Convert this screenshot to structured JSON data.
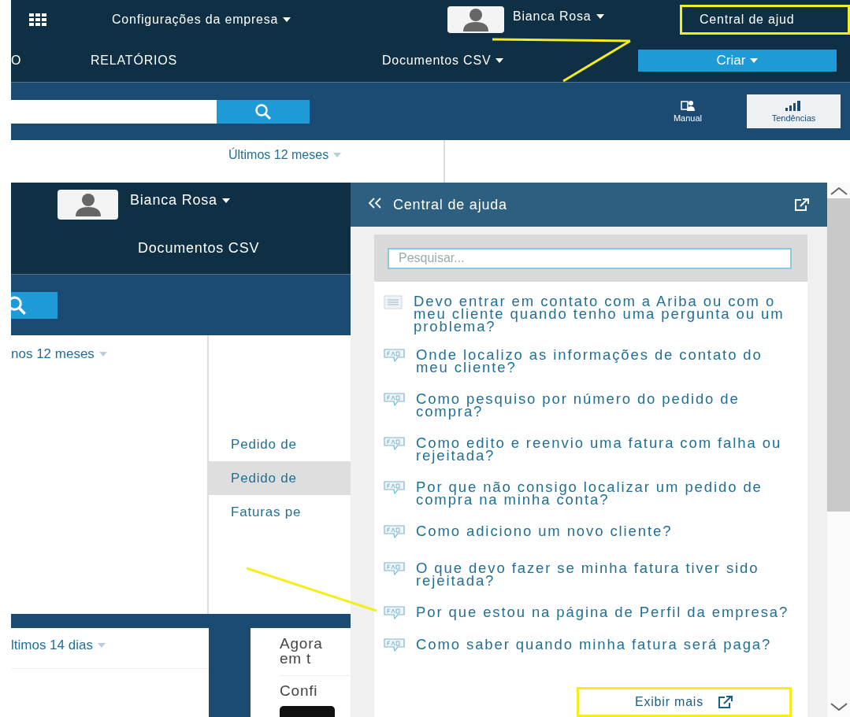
{
  "top_view": {
    "company_menu": "Configurações da empresa",
    "user_name": "Bianca Rosa",
    "help_link": {
      "label": "Central de ajud",
      "highlighted": true
    },
    "nav_items": [
      {
        "label": "O"
      },
      {
        "label": "RELATÓRIOS"
      }
    ],
    "documents_menu": "Documentos CSV",
    "create_button": "Criar",
    "toolbar_buttons": [
      {
        "label": "Manual",
        "kind": "manual",
        "selected": false
      },
      {
        "label": "Tendências",
        "kind": "trends",
        "selected": true
      }
    ],
    "period_filter": "Últimos 12 meses"
  },
  "bottom_view": {
    "user_name": "Bianca Rosa",
    "documents_menu": "Documentos CSV",
    "period_filter": "nos 12 meses",
    "links": [
      {
        "label": "Pedido de",
        "selected": false
      },
      {
        "label": "Pedido de",
        "selected": true
      },
      {
        "label": "Faturas pe",
        "selected": false
      }
    ],
    "period_filter_2": "ltimos 14 dias",
    "promo_title": "Agora em t",
    "promo_subtitle": "Confi"
  },
  "help_panel": {
    "title": "Central de ajuda",
    "search_placeholder": "Pesquisar...",
    "articles": [
      {
        "kind": "document",
        "title": "Devo entrar em contato com a Ariba ou com o meu cliente quando tenho uma pergunta ou um problema?"
      },
      {
        "kind": "faq",
        "title": "Onde localizo as informações de contato do meu cliente?"
      },
      {
        "kind": "faq",
        "title": "Como pesquiso por número do pedido de compra?"
      },
      {
        "kind": "faq",
        "title": "Como edito e reenvio uma fatura com falha ou rejeitada?"
      },
      {
        "kind": "faq",
        "title": "Por que não consigo localizar um pedido de compra na minha conta?"
      },
      {
        "kind": "faq",
        "title": "Como adiciono um novo cliente?"
      },
      {
        "kind": "faq",
        "title": "O que devo fazer se minha fatura tiver sido rejeitada?"
      },
      {
        "kind": "faq",
        "title": "Por que estou na página de Perfil da empresa?"
      },
      {
        "kind": "faq",
        "title": "Como saber quando minha fatura será paga?"
      }
    ],
    "show_more": {
      "label": "Exibir mais",
      "highlighted": true
    }
  }
}
